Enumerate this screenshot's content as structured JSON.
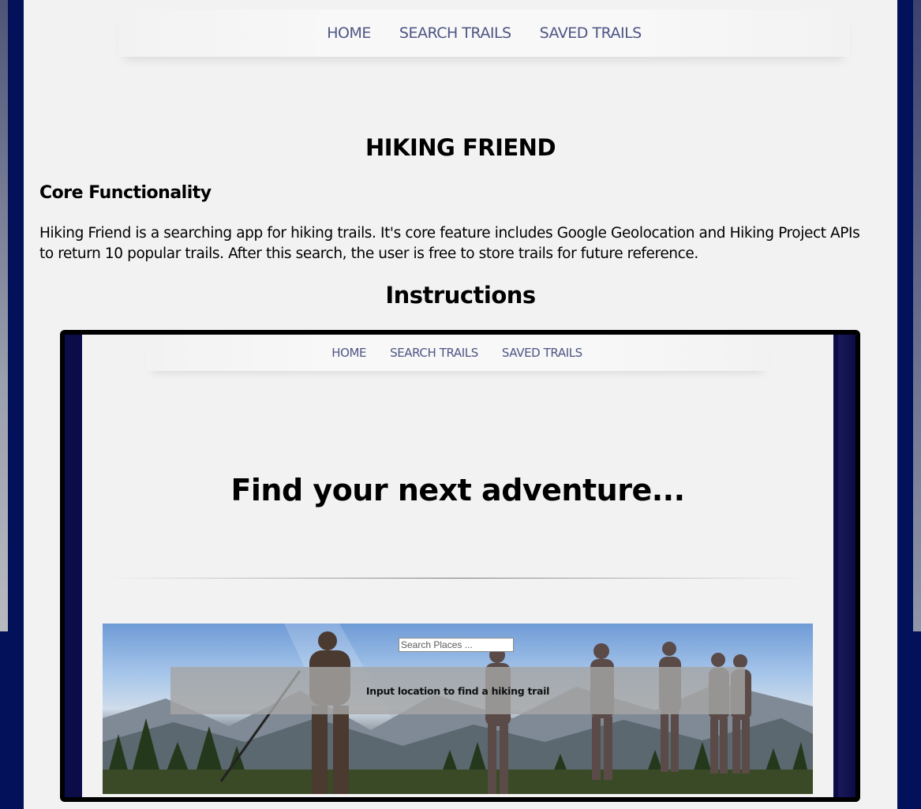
{
  "nav": {
    "home": "HOME",
    "search": "SEARCH TRAILS",
    "saved": "SAVED TRAILS"
  },
  "title": "HIKING FRIEND",
  "core": {
    "heading": "Core Functionality",
    "text": "Hiking Friend is a searching app for hiking trails. It's core feature includes Google Geolocation and Hiking Project APIs to return 10 popular trails. After this search, the user is free to store trails for future reference."
  },
  "instructions": {
    "heading": "Instructions"
  },
  "screenshot": {
    "nav": {
      "home": "HOME",
      "search": "SEARCH TRAILS",
      "saved": "SAVED TRAILS"
    },
    "hero": "Find your next adventure...",
    "search_placeholder": "Search Places ...",
    "hint": "Input location to find a hiking trail"
  },
  "colors": {
    "background": "#03105a",
    "page": "#f2f2f2",
    "nav_link": "#4e5585"
  }
}
